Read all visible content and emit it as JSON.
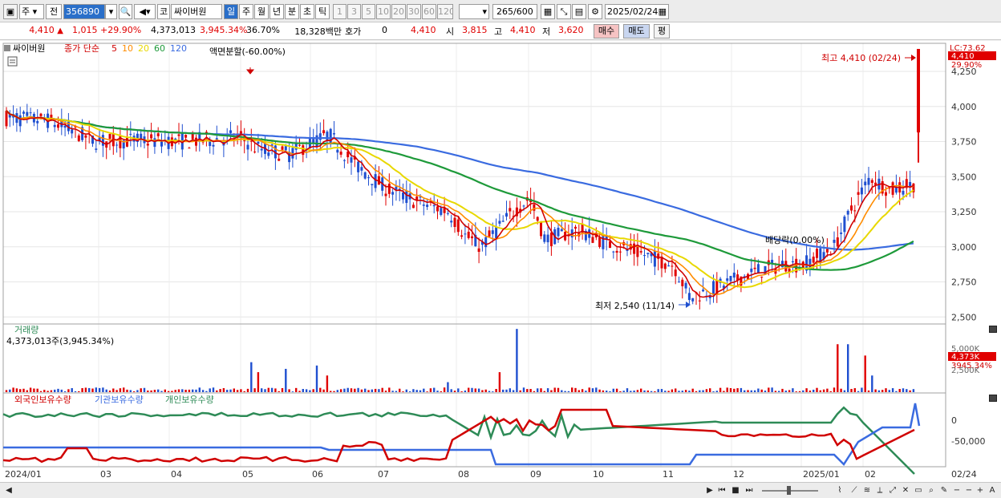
{
  "toolbar": {
    "market": "주",
    "type": "전",
    "code": "356890",
    "exchange_icon": "코",
    "name": "싸이버원",
    "periods": [
      "일",
      "주",
      "월",
      "년",
      "분",
      "초",
      "틱"
    ],
    "active_period": "일",
    "minutes": [
      "1",
      "3",
      "5",
      "10",
      "20",
      "30",
      "60",
      "120"
    ],
    "count": "265",
    "count_max": "/600",
    "date": "2025/02/24"
  },
  "quote": {
    "price": "4,410",
    "change": "1,015",
    "change_pct": "+29.90%",
    "volume": "4,373,013",
    "volume_pct": "3,945.34%",
    "turnover": "36.70%",
    "amount": "18,328백만",
    "hoga_label": "호가",
    "hoga_value": "0",
    "hoga_price": "4,410",
    "open_label": "시",
    "open": "3,815",
    "high_label": "고",
    "high": "4,410",
    "low_label": "저",
    "low": "3,620",
    "buy_label": "매수",
    "sell_label": "매도",
    "eval_label": "평"
  },
  "chart": {
    "stock_name": "싸이버원",
    "series_label": "종가 단순",
    "ma_periods": [
      "5",
      "10",
      "20",
      "60",
      "120"
    ],
    "ma_colors": [
      "#d00000",
      "#ff8c00",
      "#e8d800",
      "#1e9a3a",
      "#3a6be0"
    ],
    "y_ticks": [
      "4,250",
      "4,000",
      "3,750",
      "3,500",
      "3,250",
      "3,000",
      "2,750",
      "2,500"
    ],
    "y_top_label": "LC:73.62",
    "price_badge": "4,410",
    "price_pct_badge": "29.90%",
    "annot_split": "액면분할(-60.00%)",
    "annot_high": "최고 4,410 (02/24)",
    "annot_low": "최저 2,540 (11/14)",
    "annot_ex": "배당락(0.00%)",
    "x_labels": [
      "2024/01",
      "03",
      "04",
      "05",
      "06",
      "07",
      "08",
      "09",
      "10",
      "11",
      "12",
      "2025/01",
      "02",
      "02/24"
    ]
  },
  "volume_panel": {
    "title": "거래량",
    "value": "4,373,013주(3,945.34%)",
    "y_ticks": [
      "5,000K",
      "2,500K"
    ],
    "badge": "4,373K",
    "badge_pct": "3945.34%"
  },
  "holdings_panel": {
    "legend": [
      "외국인보유수량",
      "기관보유수량",
      "개인보유수량"
    ],
    "legend_colors": [
      "#d00000",
      "#3a6be0",
      "#2e8b57"
    ],
    "y_ticks": [
      "0",
      "-50,000"
    ]
  },
  "colors": {
    "up": "#e00000",
    "down": "#1f4fd0",
    "accent": "#2a6fc9"
  },
  "chart_data": {
    "type": "line",
    "title": "싸이버원",
    "ylim": [
      2450,
      4450
    ],
    "x": [
      "2024/01",
      "03",
      "04",
      "05",
      "06",
      "07",
      "08",
      "09",
      "10",
      "11",
      "12",
      "2025/01",
      "02",
      "02/24"
    ],
    "series": [
      {
        "name": "종가",
        "values": [
          3950,
          3850,
          3770,
          3700,
          3750,
          3580,
          3520,
          3250,
          3200,
          3000,
          2820,
          2700,
          2900,
          2950,
          3350,
          3400,
          4410
        ]
      },
      {
        "name": "120",
        "values": [
          3840,
          3860,
          3830,
          3800,
          3790,
          3760,
          3700,
          3600,
          3450,
          3300,
          3180,
          3080,
          3000,
          3010,
          3030
        ]
      },
      {
        "name": "60",
        "values": [
          3760,
          3850,
          3880,
          3830,
          3780,
          3680,
          3540,
          3380,
          3200,
          3090,
          2970,
          2880,
          2860,
          2900,
          3080
        ]
      }
    ],
    "volume_max_label": "5,000K",
    "annotations": [
      "최고 4,410 (02/24)",
      "최저 2,540 (11/14)",
      "액면분할(-60.00%)",
      "배당락(0.00%)"
    ]
  }
}
